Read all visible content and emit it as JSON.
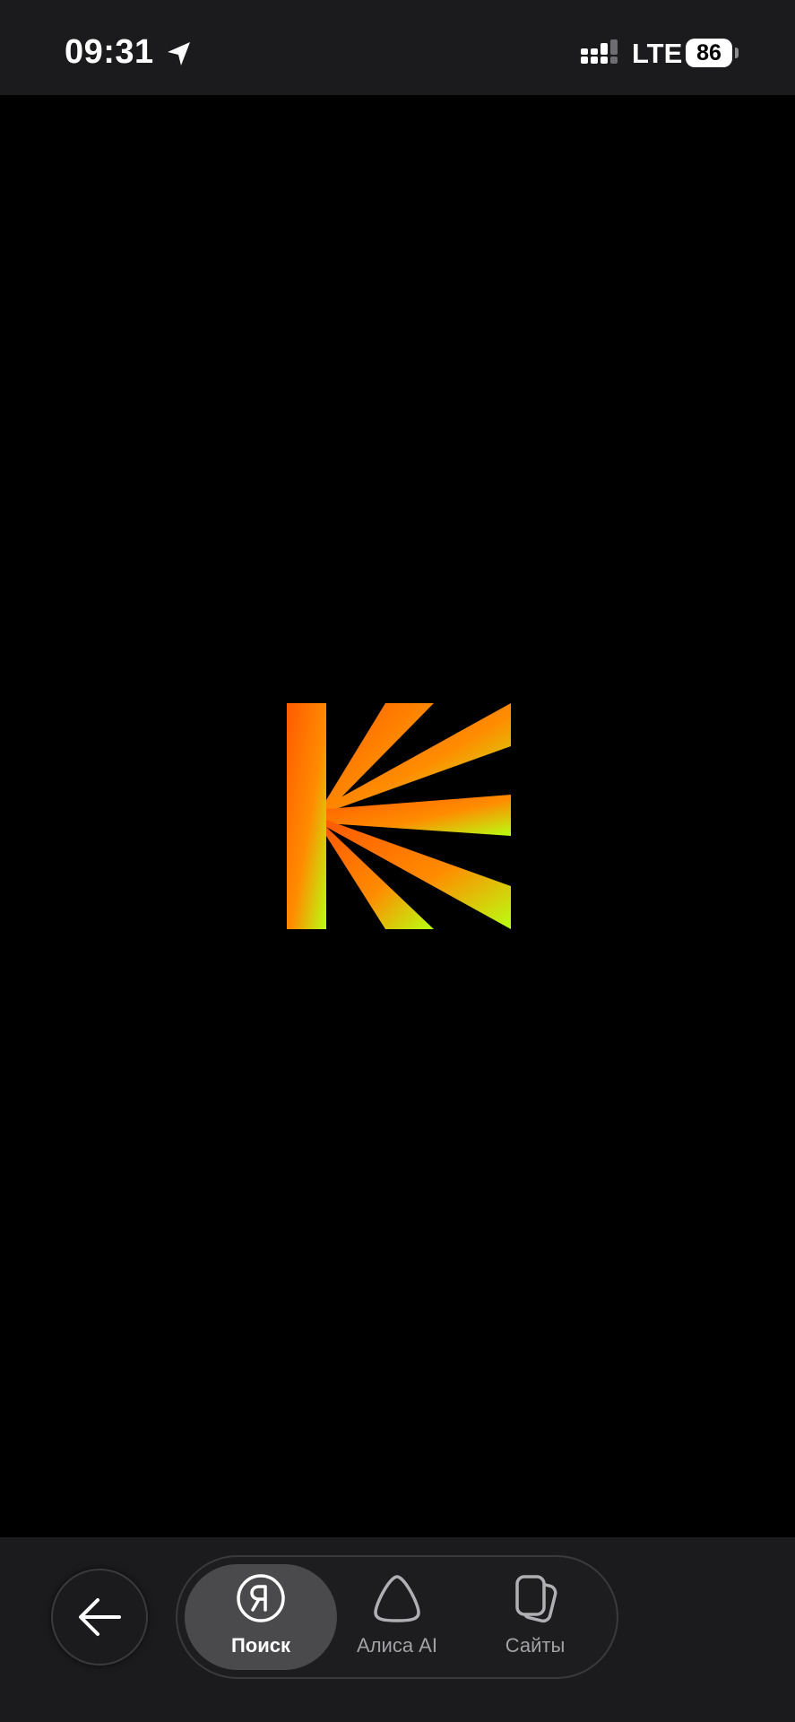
{
  "status_bar": {
    "time": "09:31",
    "network": "LTE",
    "battery": "86",
    "icons": [
      "location-arrow-icon",
      "cellular-signal-icon",
      "battery-icon"
    ]
  },
  "content": {
    "logo": "kion-logo",
    "background_color": "#000000",
    "logo_gradient": [
      "#ff5a00",
      "#ff8c00",
      "#b8ff12"
    ]
  },
  "bottom_nav": {
    "back_icon": "arrow-left-icon",
    "tabs": [
      {
        "label": "Поиск",
        "icon": "yandex-ya-icon",
        "active": true
      },
      {
        "label": "Алиса AI",
        "icon": "alice-icon",
        "active": false
      },
      {
        "label": "Сайты",
        "icon": "tabs-cards-icon",
        "active": false
      }
    ]
  },
  "colors": {
    "bar_background": "#1b1b1d",
    "active_tab": "#4a4a4c",
    "inactive_label": "#a2a2a6"
  }
}
